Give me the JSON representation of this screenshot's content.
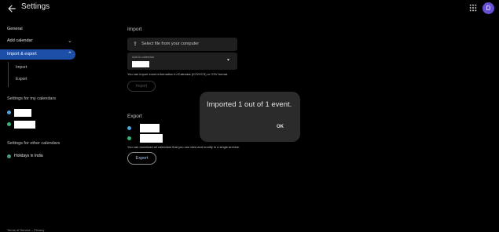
{
  "header": {
    "title": "Settings",
    "avatar_letter": "D"
  },
  "sidebar": {
    "general": "General",
    "add_calendar": "Add calendar",
    "import_export": "Import & export",
    "sub_import": "Import",
    "sub_export": "Export",
    "my_calendars_head": "Settings for my calendars",
    "other_calendars_head": "Settings for other calendars",
    "holidays": "Holidays in India",
    "colors": {
      "blue": "#4fa3d9",
      "green": "#33b679",
      "teal": "#4a9a7f"
    }
  },
  "main": {
    "import_head": "Import",
    "select_file": "Select file from your computer",
    "add_to_calendar": "Add to calendar",
    "import_hint": "You can import event information in iCalendar (ICS/VCS) or CSV format.",
    "import_button": "Import",
    "export_head": "Export",
    "export_hint": "You can download all calendars that you can view and modify in a single archive.",
    "export_button": "Export"
  },
  "dialog": {
    "message": "Imported 1 out of 1 event.",
    "ok": "OK"
  },
  "footer": "Terms of Service – Privacy"
}
